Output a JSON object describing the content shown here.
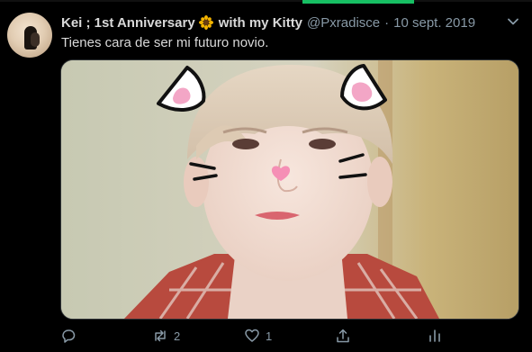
{
  "tweet": {
    "display_name": "Kei ; 1st Anniversary",
    "name_suffix": "with my Kitty",
    "handle": "@Pxradisce",
    "separator": "·",
    "date": "10 sept. 2019",
    "text": "Tienes cara de ser mi futuro novio."
  },
  "actions": {
    "retweet_count": "2",
    "like_count": "1"
  },
  "icons": {
    "emoji": "sunflower-icon",
    "menu": "chevron-down-icon",
    "reply": "reply-icon",
    "retweet": "retweet-icon",
    "like": "heart-icon",
    "share": "share-icon",
    "analytics": "analytics-icon"
  },
  "colors": {
    "background": "#000000",
    "primary_text": "#d9d9d9",
    "secondary_text": "#8899a6",
    "accent": "#17bf63"
  }
}
